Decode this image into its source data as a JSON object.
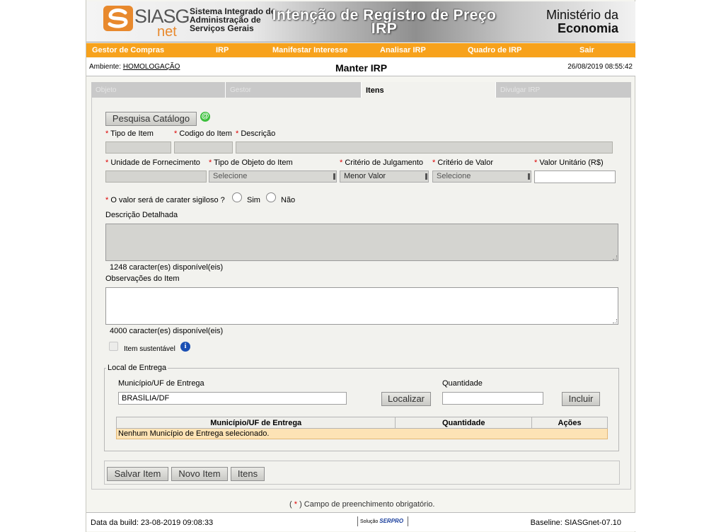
{
  "header": {
    "logo_text": "SIASG",
    "logo_net": "net",
    "system_name_lines": [
      "Sistema Integrado de",
      "Administração de",
      "Serviços Gerais"
    ],
    "title_line1": "Intenção de Registro de Preço",
    "title_line2": "IRP",
    "ministry_line1": "Ministério da",
    "ministry_line2": "Economia"
  },
  "nav": {
    "items": [
      "Gestor de Compras",
      "IRP",
      "Manifestar Interesse",
      "Analisar IRP",
      "Quadro de IRP",
      "Sair"
    ],
    "color": "#f7a21c"
  },
  "ambient": {
    "label": "Ambiente:",
    "env": "HOMOLOGAÇÃO",
    "page_title": "Manter IRP",
    "datetime": "26/08/2019 08:55:42"
  },
  "tabs": [
    {
      "label": "Objeto",
      "active": false
    },
    {
      "label": "Gestor",
      "active": false
    },
    {
      "label": "Itens",
      "active": true
    },
    {
      "label": "Divulgar IRP",
      "active": false
    }
  ],
  "form": {
    "catalog_button": "Pesquisa Catálogo",
    "at_icon_glyph": "@",
    "required_mark": "*",
    "tipo_item_label": "Tipo de Item",
    "codigo_item_label": "Codigo do Item",
    "descricao_label": "Descrição",
    "unidade_label": "Unidade de Fornecimento",
    "tipo_objeto_label": "Tipo de Objeto do Item",
    "tipo_objeto_value": "Selecione",
    "criterio_julgamento_label": "Critério de Julgamento",
    "criterio_julgamento_value": "Menor Valor",
    "criterio_valor_label": "Critério de Valor",
    "criterio_valor_value": "Selecione",
    "valor_unitario_label": "Valor Unitário (R$)",
    "sigiloso_label": "O valor será de carater sigiloso ?",
    "sim_label": "Sim",
    "nao_label": "Não",
    "descricao_detalhada_label": "Descrição Detalhada",
    "descricao_detalhada_counter": "1248 caracter(es) disponível(eis)",
    "observacoes_label": "Observações do Item",
    "observacoes_counter": "4000 caracter(es) disponível(eis)",
    "item_sustentavel_label": "Item sustentável",
    "info_icon_glyph": "i"
  },
  "local_entrega": {
    "legend": "Local de Entrega",
    "municipio_label": "Município/UF de Entrega",
    "municipio_value": "BRASÍLIA/DF",
    "quantidade_label": "Quantidade",
    "localizar_button": "Localizar",
    "incluir_button": "Incluir",
    "table_headers": [
      "Município/UF de Entrega",
      "Quantidade",
      "Ações"
    ],
    "empty_message": "Nenhum Município de Entrega selecionado."
  },
  "actions": {
    "save_item": "Salvar Item",
    "new_item": "Novo Item",
    "items": "Itens"
  },
  "footnote": {
    "open": "( ",
    "mark": "*",
    "close": " ) Campo de preenchimento obrigatório."
  },
  "footer": {
    "build_date": "Data da build: 23-08-2019 09:08:33",
    "solution_label": "Solução",
    "serpro": "SERPRO",
    "baseline": "Baseline: SIASGnet-07.10"
  }
}
